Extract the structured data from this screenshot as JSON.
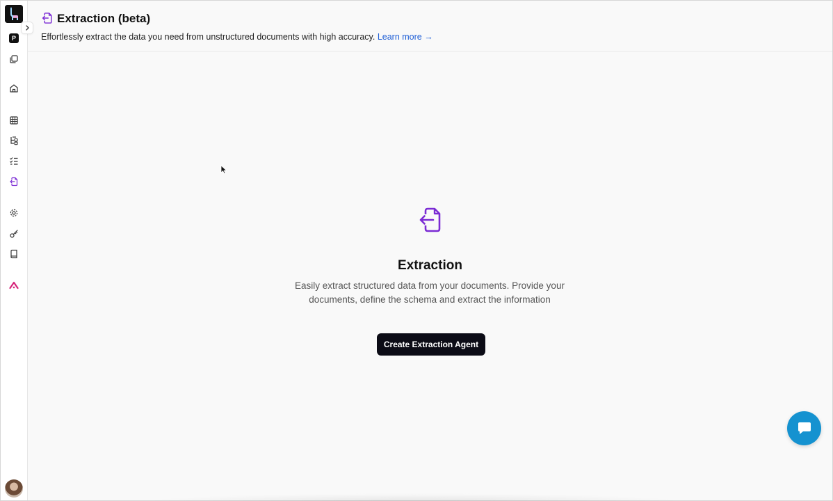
{
  "header": {
    "title": "Extraction (beta)",
    "subtitle": "Effortlessly extract the data you need from unstructured documents with high accuracy.",
    "learn_more": "Learn more →"
  },
  "sidebar": {
    "project_badge": "P",
    "items": [
      {
        "icon": "files-icon"
      },
      {
        "icon": "home-icon"
      },
      {
        "icon": "grid-icon"
      },
      {
        "icon": "tree-icon"
      },
      {
        "icon": "checklist-icon"
      },
      {
        "icon": "extraction-icon",
        "active": true
      },
      {
        "icon": "gear-icon"
      },
      {
        "icon": "key-icon"
      },
      {
        "icon": "book-icon"
      },
      {
        "icon": "brand-icon"
      }
    ]
  },
  "empty_state": {
    "title": "Extraction",
    "description": "Easily extract structured data from your documents. Provide your documents, define the schema and extract the information",
    "button": "Create Extraction Agent"
  },
  "colors": {
    "accent": "#7b2bd4",
    "link": "#1f5fd6",
    "button": "#0c0c16",
    "chat": "#1592d0",
    "brand": "#d6247a"
  }
}
